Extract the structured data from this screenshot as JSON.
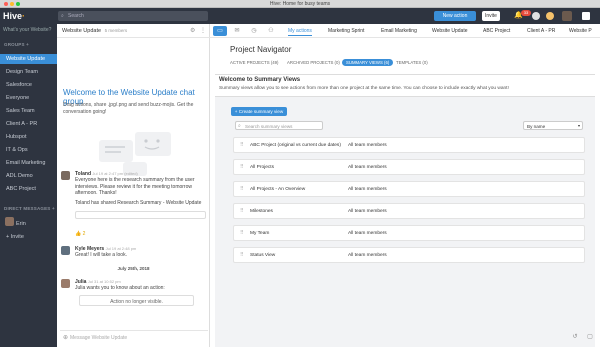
{
  "window": {
    "title": "Hive: Home for busy teams"
  },
  "topbar": {
    "logo_text": "Hive",
    "search_placeholder": "Search",
    "new_action_label": "New action",
    "invite_label": "Invite",
    "notification_count": "33"
  },
  "sidebar": {
    "workspace_label": "What's your Website?",
    "groups_header": "GROUPS +",
    "groups": [
      {
        "label": "Website Update",
        "active": true
      },
      {
        "label": "Design Team"
      },
      {
        "label": "Salesforce"
      },
      {
        "label": "Everyone"
      },
      {
        "label": "Sales Team"
      },
      {
        "label": "Client A - PR"
      },
      {
        "label": "Hubspot"
      },
      {
        "label": "IT & Ops"
      },
      {
        "label": "Email Marketing"
      },
      {
        "label": "ADL Demo"
      },
      {
        "label": "ABC Project"
      }
    ],
    "dm_header": "DIRECT MESSAGES +",
    "dm_user": "Erin",
    "invite_label": "+ Invite"
  },
  "chat": {
    "title": "Website Update",
    "members": "5 members",
    "welcome_title": "Welcome to the Website Update chat group",
    "intro": "Drag actions, share .jpg/.png and send buzz-mojis. Get the conversation going!",
    "messages": [
      {
        "name": "Toland",
        "time": "Jul 19 at 2:47 pm (edited)",
        "text": "Everyone here is the research summary from the user interviews. Please review it for the meeting tomorrow afternoon. Thanks!",
        "text2": "Toland has shared Research Summary - Website Update"
      },
      {
        "name": "Kyle Meyers",
        "time": "Jul 19 at 2:48 pm",
        "text": "Great! I will take a look."
      },
      {
        "name": "Julia",
        "time": "Jul 31 at 10:52 pm",
        "text": "Julia wants you to know about an action:"
      }
    ],
    "reaction": "👍 2",
    "day_divider": "July 25th, 2018",
    "no_action_label": "Action no longer visible.",
    "composer_placeholder": "Message Website Update"
  },
  "main": {
    "tabs": [
      {
        "label": "My actions",
        "active": true
      },
      {
        "label": "Marketing Sprint"
      },
      {
        "label": "Email Marketing"
      },
      {
        "label": "Website Update"
      },
      {
        "label": "ABC Project"
      },
      {
        "label": "Client A - PR"
      },
      {
        "label": "Website P"
      }
    ],
    "title": "Project Navigator",
    "subtabs": [
      {
        "label": "ACTIVE PROJECTS (49)"
      },
      {
        "label": "ARCHIVED PROJECTS (0)"
      },
      {
        "label": "SUMMARY VIEWS (6)",
        "active": true
      },
      {
        "label": "TEMPLATES (0)"
      }
    ],
    "panel": {
      "title": "Welcome to Summary Views",
      "description": "Summary views allow you to see actions from more than one project at the same time. You can choose to include exactly what you want!",
      "create_label": "+ Create summary view",
      "search_placeholder": "Search summary views",
      "sort_label": "By name",
      "views": [
        {
          "name": "ABC Project (original vs current due dates)",
          "members": "All team members"
        },
        {
          "name": "All Projects",
          "members": "All team members"
        },
        {
          "name": "All Projects - An Overview",
          "members": "All team members"
        },
        {
          "name": "Milestones",
          "members": "All team members"
        },
        {
          "name": "My Team",
          "members": "All team members"
        },
        {
          "name": "Status View",
          "members": "All team members"
        }
      ]
    }
  },
  "colors": {
    "accent": "#3a8fd8",
    "sidebar_bg": "#2e3440",
    "active_group": "#3a8fd8"
  }
}
